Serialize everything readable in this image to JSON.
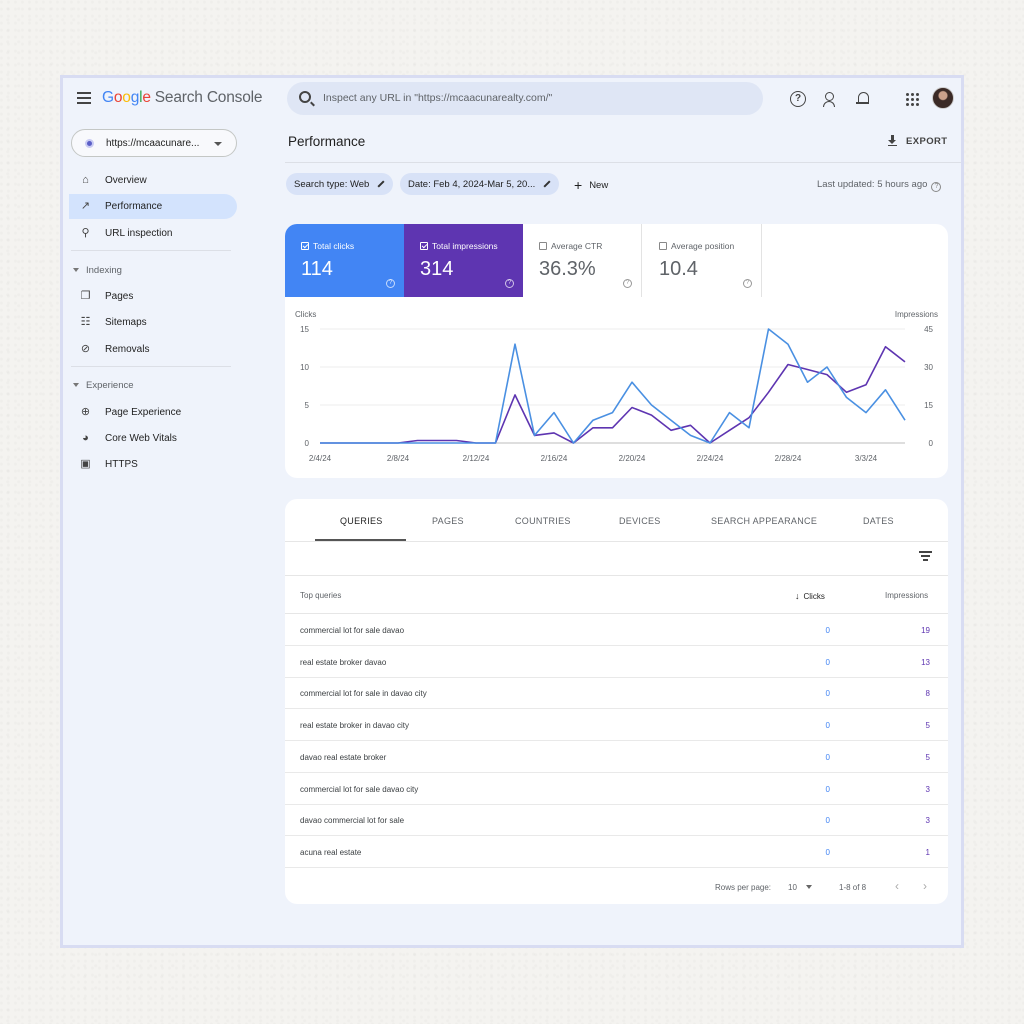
{
  "header": {
    "logo_google": [
      "G",
      "o",
      "o",
      "g",
      "l",
      "e"
    ],
    "logo_product": "Search Console",
    "search_placeholder": "Inspect any URL in \"https://mcaacunarealty.com/\""
  },
  "sidebar": {
    "property": "https://mcaacunare...",
    "items_top": [
      {
        "label": "Overview",
        "icon": "home-icon"
      },
      {
        "label": "Performance",
        "icon": "trending-up-icon",
        "active": true
      },
      {
        "label": "URL inspection",
        "icon": "search-icon"
      }
    ],
    "indexing_header": "Indexing",
    "indexing_items": [
      {
        "label": "Pages",
        "icon": "pages-icon"
      },
      {
        "label": "Sitemaps",
        "icon": "sitemap-icon"
      },
      {
        "label": "Removals",
        "icon": "eye-off-icon"
      }
    ],
    "experience_header": "Experience",
    "experience_items": [
      {
        "label": "Page Experience",
        "icon": "plus-circle-icon"
      },
      {
        "label": "Core Web Vitals",
        "icon": "gauge-icon"
      },
      {
        "label": "HTTPS",
        "icon": "lock-icon"
      }
    ]
  },
  "main": {
    "title": "Performance",
    "export_label": "EXPORT",
    "filter_search_type": "Search type: Web",
    "filter_date": "Date: Feb 4, 2024-Mar 5, 20...",
    "new_label": "New",
    "last_updated": "Last updated: 5 hours ago"
  },
  "metrics": {
    "clicks": {
      "label": "Total clicks",
      "value": "114",
      "checked": true,
      "color": "#4285f4"
    },
    "impressions": {
      "label": "Total impressions",
      "value": "314",
      "checked": true,
      "color": "#5e35b1"
    },
    "ctr": {
      "label": "Average CTR",
      "value": "36.3%",
      "checked": false
    },
    "position": {
      "label": "Average position",
      "value": "10.4",
      "checked": false
    }
  },
  "chart_data": {
    "type": "line",
    "x": [
      "2/4/24",
      "2/5/24",
      "2/6/24",
      "2/7/24",
      "2/8/24",
      "2/9/24",
      "2/10/24",
      "2/11/24",
      "2/12/24",
      "2/13/24",
      "2/14/24",
      "2/15/24",
      "2/16/24",
      "2/17/24",
      "2/18/24",
      "2/19/24",
      "2/20/24",
      "2/21/24",
      "2/22/24",
      "2/23/24",
      "2/24/24",
      "2/25/24",
      "2/26/24",
      "2/27/24",
      "2/28/24",
      "2/29/24",
      "3/1/24",
      "3/2/24",
      "3/3/24",
      "3/4/24",
      "3/5/24"
    ],
    "x_tick_labels": [
      "2/4/24",
      "2/8/24",
      "2/12/24",
      "2/16/24",
      "2/20/24",
      "2/24/24",
      "2/28/24",
      "3/3/24"
    ],
    "series": [
      {
        "name": "Clicks",
        "axis": "left",
        "color": "#4a90e2",
        "values": [
          0,
          0,
          0,
          0,
          0,
          0,
          0,
          0,
          0,
          0,
          13,
          1,
          4,
          0,
          3,
          4,
          8,
          5,
          3,
          1,
          0,
          4,
          2,
          15,
          13,
          8,
          10,
          6,
          4,
          7,
          3
        ]
      },
      {
        "name": "Impressions",
        "axis": "right",
        "color": "#5e35b1",
        "values": [
          0,
          0,
          0,
          0,
          0,
          1,
          1,
          1,
          0,
          0,
          19,
          3,
          4,
          0,
          6,
          6,
          14,
          11,
          5,
          7,
          0,
          5,
          10,
          20,
          31,
          29,
          27,
          20,
          23,
          38,
          32
        ]
      }
    ],
    "ylabel_left": "Clicks",
    "ylabel_right": "Impressions",
    "y_left_ticks": [
      "0",
      "5",
      "10",
      "15"
    ],
    "y_right_ticks": [
      "0",
      "15",
      "30",
      "45"
    ],
    "ylim_left": [
      0,
      15
    ],
    "ylim_right": [
      0,
      45
    ],
    "grid": true
  },
  "tabs": [
    "QUERIES",
    "PAGES",
    "COUNTRIES",
    "DEVICES",
    "SEARCH APPEARANCE",
    "DATES"
  ],
  "table": {
    "col_query": "Top queries",
    "col_clicks": "Clicks",
    "col_impressions": "Impressions",
    "rows": [
      {
        "query": "commercial lot for sale davao",
        "clicks": "0",
        "impressions": "19"
      },
      {
        "query": "real estate broker davao",
        "clicks": "0",
        "impressions": "13"
      },
      {
        "query": "commercial lot for sale in davao city",
        "clicks": "0",
        "impressions": "8"
      },
      {
        "query": "real estate broker in davao city",
        "clicks": "0",
        "impressions": "5"
      },
      {
        "query": "davao real estate broker",
        "clicks": "0",
        "impressions": "5"
      },
      {
        "query": "commercial lot for sale davao city",
        "clicks": "0",
        "impressions": "3"
      },
      {
        "query": "davao commercial lot for sale",
        "clicks": "0",
        "impressions": "3"
      },
      {
        "query": "acuna real estate",
        "clicks": "0",
        "impressions": "1"
      }
    ],
    "rows_per_page_label": "Rows per page:",
    "rows_per_page": "10",
    "range": "1-8 of 8"
  }
}
